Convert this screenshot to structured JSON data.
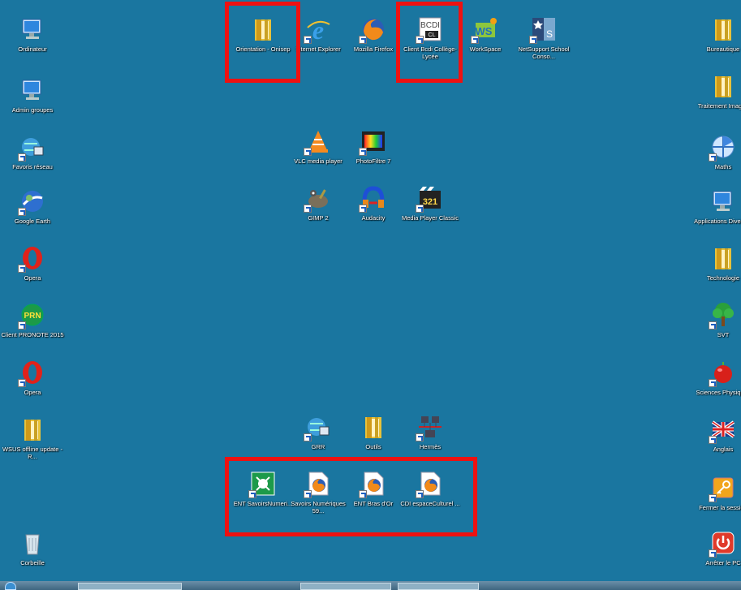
{
  "desktop": {
    "left_column": [
      {
        "name": "ordinateur",
        "label": "Ordinateur",
        "icon": "computer-icon"
      },
      {
        "name": "admin-groupes",
        "label": "Admin groupes",
        "icon": "computer-icon"
      },
      {
        "name": "favoris-reseau",
        "label": "Favoris réseau",
        "icon": "network-icon"
      },
      {
        "name": "google-earth",
        "label": "Google Earth",
        "icon": "google-earth-icon"
      },
      {
        "name": "opera-1",
        "label": "Opera",
        "icon": "opera-icon"
      },
      {
        "name": "client-pronote",
        "label": "Client PRONOTE 2015",
        "icon": "pronote-icon"
      },
      {
        "name": "opera-2",
        "label": "Opera",
        "icon": "opera-icon"
      },
      {
        "name": "wsus-offline",
        "label": "WSUS offline update - R...",
        "icon": "folder-icon"
      },
      {
        "name": "corbeille",
        "label": "Corbeille",
        "icon": "recycle-bin-icon"
      }
    ],
    "top_row": [
      {
        "name": "orientation-onisep",
        "label": "Orientation - Onisep",
        "icon": "folder-icon"
      },
      {
        "name": "internet-explorer",
        "label": "Internet Explorer",
        "icon": "internet-explorer-icon"
      },
      {
        "name": "mozilla-firefox",
        "label": "Mozilla Firefox",
        "icon": "firefox-icon"
      },
      {
        "name": "client-bcdi",
        "label": "Client Bcdi Collège-Lycée",
        "icon": "bcdi-icon"
      },
      {
        "name": "workspace",
        "label": "WorkSpace",
        "icon": "workspace-icon"
      },
      {
        "name": "netsupport",
        "label": "NetSupport School Conso...",
        "icon": "netsupport-icon"
      }
    ],
    "media_row1": [
      {
        "name": "vlc",
        "label": "VLC media player",
        "icon": "vlc-icon"
      },
      {
        "name": "photofiltre",
        "label": "PhotoFiltre 7",
        "icon": "photofiltre-icon"
      }
    ],
    "media_row2": [
      {
        "name": "gimp",
        "label": "GIMP 2",
        "icon": "gimp-icon"
      },
      {
        "name": "audacity",
        "label": "Audacity",
        "icon": "audacity-icon"
      },
      {
        "name": "media-player-classic",
        "label": "Media Player Classic",
        "icon": "media-player-classic-icon"
      }
    ],
    "tools_row": [
      {
        "name": "grr",
        "label": "GRR",
        "icon": "network-icon"
      },
      {
        "name": "outils",
        "label": "Outils",
        "icon": "folder-icon"
      },
      {
        "name": "hermes",
        "label": "Hermès",
        "icon": "hermes-icon"
      }
    ],
    "bottom_row": [
      {
        "name": "ent-savoirs",
        "label": "ENT SavoirsNumeri...",
        "icon": "ent-icon"
      },
      {
        "name": "savoirs-numeriques",
        "label": "Savoirs Numériques 59...",
        "icon": "firefox-file-icon"
      },
      {
        "name": "ent-bras-dor",
        "label": "ENT Bras d'Or",
        "icon": "firefox-file-icon"
      },
      {
        "name": "cdi-espace",
        "label": "CDI espaceCulturel ...",
        "icon": "firefox-file-icon"
      }
    ],
    "right_column": [
      {
        "name": "bureautique",
        "label": "Bureautique",
        "icon": "folder-icon"
      },
      {
        "name": "traitement-images",
        "label": "Traitement Images",
        "icon": "folder-icon"
      },
      {
        "name": "maths",
        "label": "Maths",
        "icon": "maths-icon"
      },
      {
        "name": "applications-diverses",
        "label": "Applications Diverses",
        "icon": "computer-icon"
      },
      {
        "name": "technologie",
        "label": "Technologie",
        "icon": "folder-icon"
      },
      {
        "name": "svt",
        "label": "SVT",
        "icon": "tree-icon"
      },
      {
        "name": "sciences-physiques",
        "label": "Sciences Physiques",
        "icon": "apple-icon"
      },
      {
        "name": "anglais",
        "label": "Anglais",
        "icon": "flag-uk-icon"
      },
      {
        "name": "fermer-session",
        "label": "Fermer la session",
        "icon": "key-icon"
      },
      {
        "name": "arreter-pc",
        "label": "Arrêter le PC",
        "icon": "power-icon"
      }
    ]
  },
  "colors": {
    "desktop": "#1a76a0",
    "highlight": "#ee1111"
  }
}
